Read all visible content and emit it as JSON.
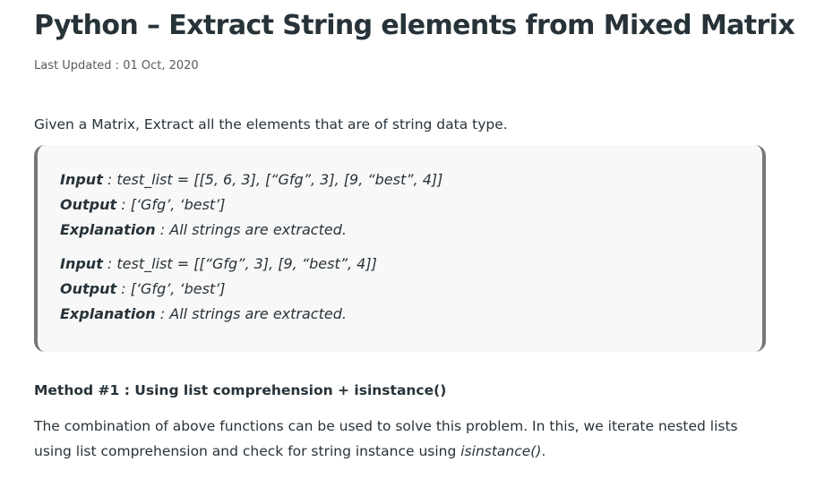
{
  "article": {
    "title": "Python – Extract String elements from Mixed Matrix",
    "last_updated": "Last Updated : 01 Oct, 2020",
    "intro": "Given a Matrix, Extract all the elements that are of string data type.",
    "examples": [
      {
        "input_label": "Input",
        "input_text": " : test_list = [[5, 6, 3], [“Gfg”, 3], [9, “best”, 4]]",
        "output_label": "Output",
        "output_text": " : [‘Gfg’, ‘best’]",
        "explanation_label": "Explanation",
        "explanation_text": " : All strings are extracted."
      },
      {
        "input_label": "Input",
        "input_text": " : test_list = [[“Gfg”, 3], [9, “best”, 4]]",
        "output_label": "Output",
        "output_text": " : [‘Gfg’, ‘best’]",
        "explanation_label": "Explanation",
        "explanation_text": " : All strings are extracted."
      }
    ],
    "method_heading": "Method #1 : Using list comprehension + isinstance()",
    "method_para_text": "The combination of above functions can be used to solve this problem. In this, we iterate nested lists using list comprehension and check for string instance using ",
    "method_para_code": "isinstance()",
    "method_para_end": "."
  },
  "colors": {
    "text": "#273239",
    "muted": "#5a5a5a",
    "box_bg": "#f8f8f8",
    "box_border": "#777777"
  }
}
